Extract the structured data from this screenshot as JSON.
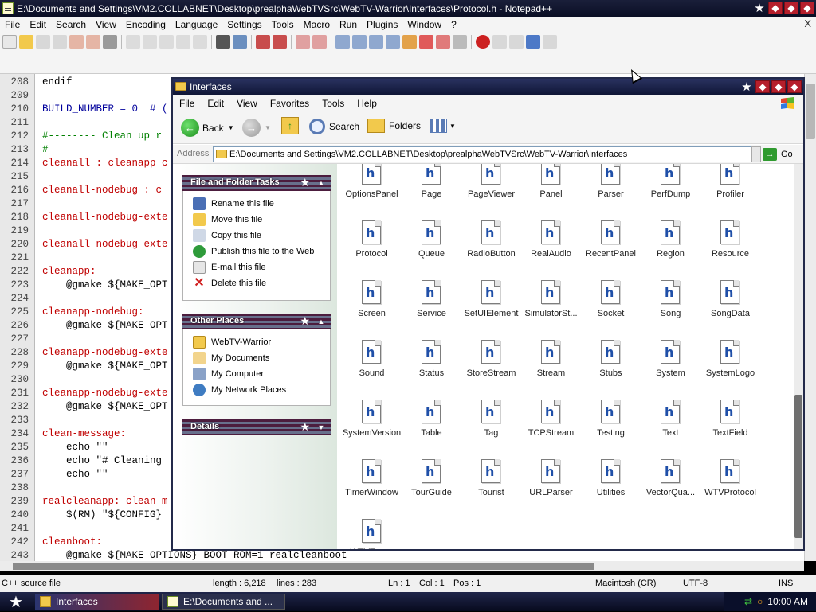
{
  "npp": {
    "title": "E:\\Documents and Settings\\VM2.COLLABNET\\Desktop\\prealphaWebTVSrc\\WebTV-Warrior\\Interfaces\\Protocol.h - Notepad++",
    "menu": [
      "File",
      "Edit",
      "Search",
      "View",
      "Encoding",
      "Language",
      "Settings",
      "Tools",
      "Macro",
      "Run",
      "Plugins",
      "Window",
      "?"
    ],
    "close_glyph": "X",
    "lines": [
      {
        "n": "208",
        "text": "endif",
        "cls": "c-default"
      },
      {
        "n": "209",
        "text": "",
        "cls": "c-default"
      },
      {
        "n": "210",
        "text": "BUILD_NUMBER = 0  # (",
        "cls": "c-var"
      },
      {
        "n": "211",
        "text": "",
        "cls": "c-default"
      },
      {
        "n": "212",
        "text": "#-------- Clean up r",
        "cls": "c-comment"
      },
      {
        "n": "213",
        "text": "#",
        "cls": "c-comment"
      },
      {
        "n": "214",
        "text": "cleanall : cleanapp c",
        "cls": "c-target"
      },
      {
        "n": "215",
        "text": "",
        "cls": "c-default"
      },
      {
        "n": "216",
        "text": "cleanall-nodebug : c",
        "cls": "c-target"
      },
      {
        "n": "217",
        "text": "",
        "cls": "c-default"
      },
      {
        "n": "218",
        "text": "cleanall-nodebug-exte",
        "cls": "c-target"
      },
      {
        "n": "219",
        "text": "",
        "cls": "c-default"
      },
      {
        "n": "220",
        "text": "cleanall-nodebug-exte",
        "cls": "c-target"
      },
      {
        "n": "221",
        "text": "",
        "cls": "c-default"
      },
      {
        "n": "222",
        "text": "cleanapp:",
        "cls": "c-target"
      },
      {
        "n": "223",
        "text": "    @gmake ${MAKE_OPT",
        "cls": "c-default"
      },
      {
        "n": "224",
        "text": "",
        "cls": "c-default"
      },
      {
        "n": "225",
        "text": "cleanapp-nodebug:",
        "cls": "c-target"
      },
      {
        "n": "226",
        "text": "    @gmake ${MAKE_OPT",
        "cls": "c-default"
      },
      {
        "n": "227",
        "text": "",
        "cls": "c-default"
      },
      {
        "n": "228",
        "text": "cleanapp-nodebug-exte",
        "cls": "c-target"
      },
      {
        "n": "229",
        "text": "    @gmake ${MAKE_OPT",
        "cls": "c-default"
      },
      {
        "n": "230",
        "text": "",
        "cls": "c-default"
      },
      {
        "n": "231",
        "text": "cleanapp-nodebug-exte",
        "cls": "c-target"
      },
      {
        "n": "232",
        "text": "    @gmake ${MAKE_OPT",
        "cls": "c-default"
      },
      {
        "n": "233",
        "text": "",
        "cls": "c-default"
      },
      {
        "n": "234",
        "text": "clean-message:",
        "cls": "c-target"
      },
      {
        "n": "235",
        "text": "    echo \"\"",
        "cls": "c-default"
      },
      {
        "n": "236",
        "text": "    echo \"# Cleaning",
        "cls": "c-default"
      },
      {
        "n": "237",
        "text": "    echo \"\"",
        "cls": "c-default"
      },
      {
        "n": "238",
        "text": "",
        "cls": "c-default"
      },
      {
        "n": "239",
        "text": "realcleanapp: clean-m",
        "cls": "c-target"
      },
      {
        "n": "240",
        "text": "    $(RM) \"${CONFIG}",
        "cls": "c-default"
      },
      {
        "n": "241",
        "text": "",
        "cls": "c-default"
      },
      {
        "n": "242",
        "text": "cleanboot:",
        "cls": "c-target"
      },
      {
        "n": "243",
        "text": "    @gmake ${MAKE_OPTIONS} BOOT_ROM=1 realcleanboot",
        "cls": "c-default"
      }
    ],
    "status": {
      "type": "C++ source file",
      "length": "length : 6,218",
      "lines": "lines : 283",
      "ln": "Ln : 1",
      "col": "Col : 1",
      "pos": "Pos : 1",
      "eol": "Macintosh (CR)",
      "enc": "UTF-8",
      "ins": "INS"
    }
  },
  "explorer": {
    "title": "Interfaces",
    "menu": [
      "File",
      "Edit",
      "View",
      "Favorites",
      "Tools",
      "Help"
    ],
    "toolbar": {
      "back": "Back",
      "search": "Search",
      "folders": "Folders"
    },
    "address_label": "Address",
    "address": "E:\\Documents and Settings\\VM2.COLLABNET\\Desktop\\prealphaWebTVSrc\\WebTV-Warrior\\Interfaces",
    "go": "Go",
    "panels": {
      "file_tasks": {
        "title": "File and Folder Tasks",
        "items": [
          "Rename this file",
          "Move this file",
          "Copy this file",
          "Publish this file to the Web",
          "E-mail this file",
          "Delete this file"
        ]
      },
      "other_places": {
        "title": "Other Places",
        "items": [
          "WebTV-Warrior",
          "My Documents",
          "My Computer",
          "My Network Places"
        ]
      },
      "details": {
        "title": "Details"
      }
    },
    "files": [
      "OptionsPanel",
      "Page",
      "PageViewer",
      "Panel",
      "Parser",
      "PerfDump",
      "Profiler",
      "Protocol",
      "Queue",
      "RadioButton",
      "RealAudio",
      "RecentPanel",
      "Region",
      "Resource",
      "Screen",
      "Service",
      "SetUIElement",
      "SimulatorSt...",
      "Socket",
      "Song",
      "SongData",
      "Sound",
      "Status",
      "StoreStream",
      "Stream",
      "Stubs",
      "System",
      "SystemLogo",
      "SystemVersion",
      "Table",
      "Tag",
      "TCPStream",
      "Testing",
      "Text",
      "TextField",
      "TimerWindow",
      "TourGuide",
      "Tourist",
      "URLParser",
      "Utilities",
      "VectorQua...",
      "WTVProtocol",
      "WTVTypes"
    ]
  },
  "taskbar": {
    "tasks": [
      "Interfaces",
      "E:\\Documents and ..."
    ],
    "clock": "10:00 AM"
  }
}
